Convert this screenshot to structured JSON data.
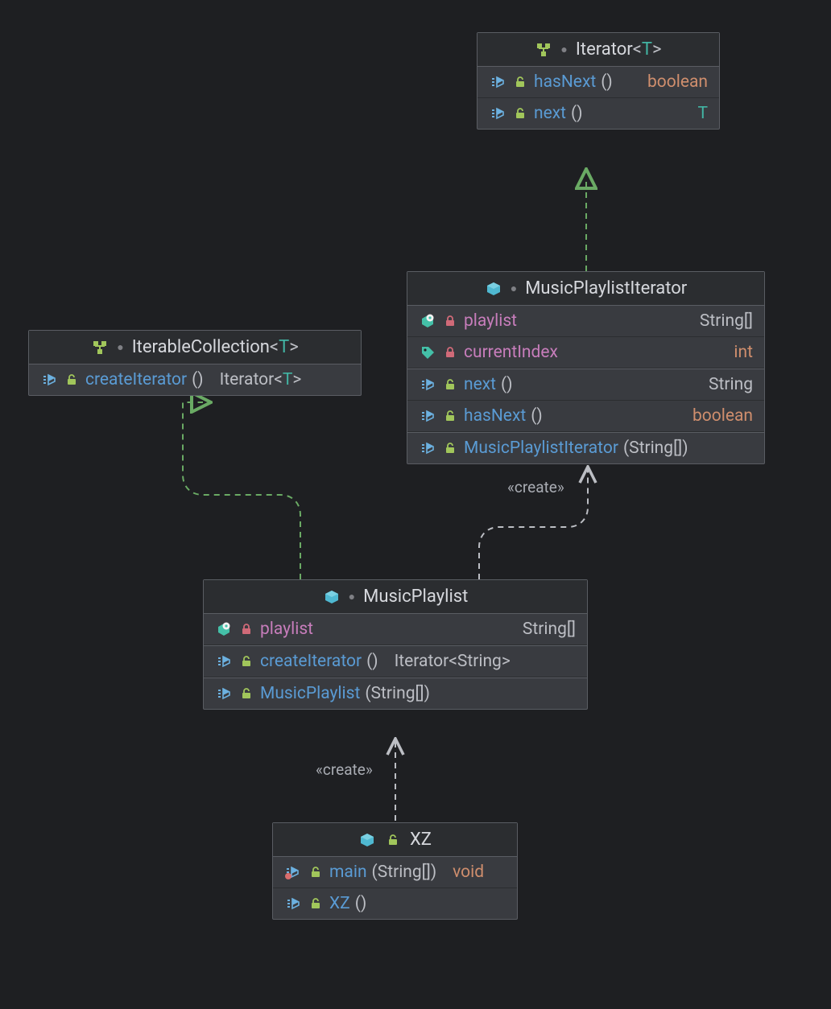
{
  "boxes": {
    "iterator": {
      "title": "Iterator",
      "gen_open": "<",
      "gen_t": "T",
      "gen_close": ">",
      "methods": [
        {
          "name": "hasNext",
          "params": "()",
          "ret": "boolean",
          "ret_style": "orange"
        },
        {
          "name": "next",
          "params": "()",
          "ret": "T",
          "ret_style": "teal"
        }
      ]
    },
    "iterable": {
      "title": "IterableCollection",
      "gen_open": "<",
      "gen_t": "T",
      "gen_close": ">",
      "methods": [
        {
          "name": "createIterator",
          "params": "()",
          "ret": "Iterator",
          "ret_gen_open": "<",
          "ret_gen_t": "T",
          "ret_gen_close": ">"
        }
      ]
    },
    "mpiter": {
      "title": "MusicPlaylistIterator",
      "fields": [
        {
          "name": "playlist",
          "type": "String[]",
          "icon": "gear"
        },
        {
          "name": "currentIndex",
          "type": "int",
          "type_style": "orange",
          "icon": "tag"
        }
      ],
      "methods": [
        {
          "name": "next",
          "params": "()",
          "ret": "String"
        },
        {
          "name": "hasNext",
          "params": "()",
          "ret": "boolean",
          "ret_style": "orange"
        },
        {
          "name": "MusicPlaylistIterator",
          "params": "(String[])"
        }
      ]
    },
    "mplaylist": {
      "title": "MusicPlaylist",
      "fields": [
        {
          "name": "playlist",
          "type": "String[]",
          "icon": "gear"
        }
      ],
      "methods": [
        {
          "name": "createIterator",
          "params": "()",
          "ret": "Iterator",
          "ret_gen_open": "<",
          "ret_gen_s": "String",
          "ret_gen_close": ">"
        },
        {
          "name": "MusicPlaylist",
          "params": "(String[])"
        }
      ]
    },
    "xz": {
      "title": "XZ",
      "methods": [
        {
          "name": "main",
          "params": "(String[])",
          "ret": "void",
          "ret_style": "orange",
          "static": true
        },
        {
          "name": "XZ",
          "params": "()"
        }
      ]
    }
  },
  "labels": {
    "create1": "«create»",
    "create2": "«create»"
  }
}
